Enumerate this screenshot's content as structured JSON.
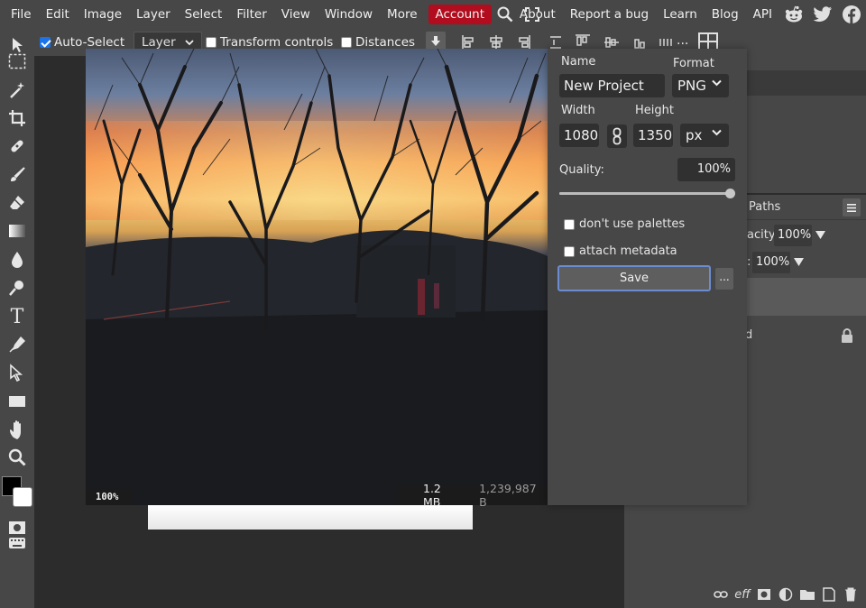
{
  "menubar": {
    "items": [
      "File",
      "Edit",
      "Image",
      "Layer",
      "Select",
      "Filter",
      "View",
      "Window",
      "More"
    ],
    "account_label": "Account",
    "right_links": [
      "About",
      "Report a bug",
      "Learn",
      "Blog",
      "API"
    ],
    "social_icons": [
      "reddit-icon",
      "twitter-icon",
      "facebook-icon"
    ]
  },
  "options": {
    "auto_select_label": "Auto-Select",
    "layer_select_value": "Layer",
    "transform_controls_label": "Transform controls",
    "distances_label": "Distances",
    "more_label": "..."
  },
  "canvas": {
    "zoom": "100%",
    "file_size": "1.2 MB",
    "file_bytes": "1,239,987 B"
  },
  "export_dialog": {
    "name_label": "Name",
    "name_value": "New Project",
    "format_label": "Format",
    "format_value": "PNG",
    "width_label": "Width",
    "width_value": "1080",
    "height_label": "Height",
    "height_value": "1350",
    "unit_value": "px",
    "quality_label": "Quality:",
    "quality_value": "100%",
    "quality_fraction": 1.0,
    "no_palettes_label": "don't use palettes",
    "attach_metadata_label": "attach metadata",
    "save_label": "Save",
    "more_label": "..."
  },
  "layers_panel": {
    "paths_tab": "Paths",
    "opacity_label": "acity:",
    "opacity_value": "100%",
    "fill_label": ":",
    "fill_value": "100%",
    "layer_name_fragment": "d"
  },
  "colors": {
    "accent_account": "#b10d1e",
    "panel_bg": "#474747",
    "workspace_bg": "#2c2c2c",
    "save_border": "#6b8cd0"
  }
}
